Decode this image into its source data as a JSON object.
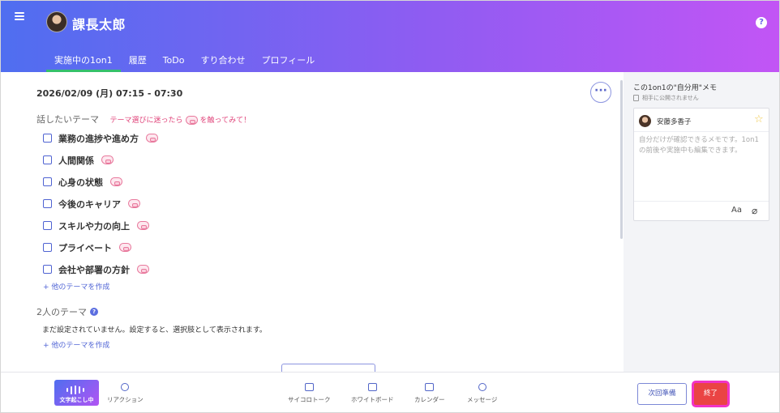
{
  "header": {
    "user_name": "課長太郎",
    "help_label": "?",
    "tabs": [
      {
        "label": "実施中の1on1"
      },
      {
        "label": "履歴"
      },
      {
        "label": "ToDo"
      },
      {
        "label": "すり合わせ"
      },
      {
        "label": "プロフィール"
      }
    ]
  },
  "session": {
    "datetime": "2026/02/09 (月) 07:15 - 07:30",
    "more_label": "···"
  },
  "themes": {
    "title": "話したいテーマ",
    "hint_prefix": "テーマ選びに迷ったら",
    "hint_suffix": "を触ってみて！",
    "items": [
      {
        "label": "業務の進捗や進め方"
      },
      {
        "label": "人間関係"
      },
      {
        "label": "心身の状態"
      },
      {
        "label": "今後のキャリア"
      },
      {
        "label": "スキルや力の向上"
      },
      {
        "label": "プライベート"
      },
      {
        "label": "会社や部署の方針"
      }
    ],
    "add_label": "+ 他のテーマを作成"
  },
  "shared": {
    "title": "2人のテーマ",
    "empty_text": "まだ設定されていません。設定すると、選択肢として表示されます。",
    "add_label": "+ 他のテーマを作成"
  },
  "memo": {
    "title": "この1on1の\"自分用\"メモ",
    "subtitle": "相手に公開されません",
    "partner_name": "安藤多香子",
    "placeholder": "自分だけが確認できるメモです。1on1の前後や実施中も編集できます。",
    "format_label": "Aa"
  },
  "footer": {
    "transcribe_label": "文字起こし中",
    "reaction_label": "リアクション",
    "dice_label": "サイコロトーク",
    "whiteboard_label": "ホワイトボード",
    "calendar_label": "カレンダー",
    "message_label": "メッセージ",
    "next_label": "次回準備",
    "end_label": "終了"
  },
  "colors": {
    "header_gradient_start": "#4f6ef0",
    "header_gradient_end": "#c255f5",
    "active_tab_indicator": "#35c06b",
    "hint_pink": "#e0447a",
    "end_button": "#ea4444",
    "end_button_border": "#f133c6"
  }
}
